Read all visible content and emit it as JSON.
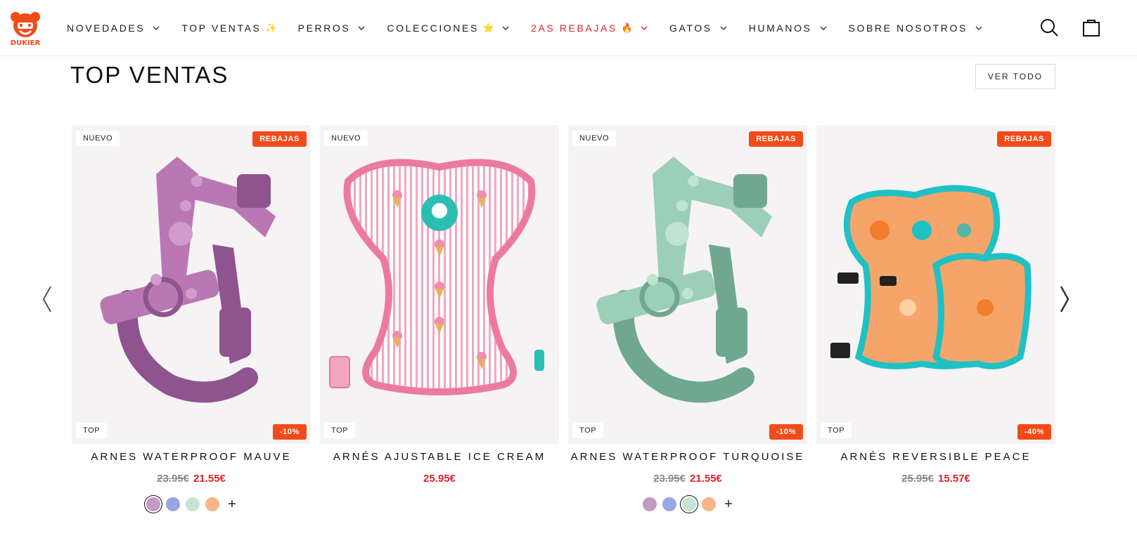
{
  "header": {
    "logo_text": "DUKIER",
    "nav": [
      {
        "label": "NOVEDADES",
        "emoji": "",
        "chevron": true,
        "sale": false
      },
      {
        "label": "TOP VENTAS",
        "emoji": "✨",
        "chevron": false,
        "sale": false
      },
      {
        "label": "PERROS",
        "emoji": "",
        "chevron": true,
        "sale": false
      },
      {
        "label": "COLECCIONES",
        "emoji": "⭐",
        "chevron": true,
        "sale": false
      },
      {
        "label": "2AS REBAJAS",
        "emoji": "🔥",
        "chevron": true,
        "sale": true
      },
      {
        "label": "GATOS",
        "emoji": "",
        "chevron": true,
        "sale": false
      },
      {
        "label": "HUMANOS",
        "emoji": "",
        "chevron": true,
        "sale": false
      },
      {
        "label": "SOBRE NOSOTROS",
        "emoji": "",
        "chevron": true,
        "sale": false
      }
    ],
    "icons": [
      "search-icon",
      "cart-icon"
    ]
  },
  "section": {
    "title": "TOP VENTAS",
    "view_all": "VER TODO"
  },
  "colors": {
    "brand": "#f14b19",
    "sale_text": "#e0212f"
  },
  "products": [
    {
      "badge_new": "NUEVO",
      "badge_sale": "REBAJAS",
      "badge_top": "TOP",
      "badge_discount": "-10%",
      "title": "ARNES WATERPROOF MAUVE",
      "old_price": "23.95€",
      "price": "21.55€",
      "variant": "mauve",
      "swatches": [
        "#c39ac4",
        "#98a6e6",
        "#c8e3d4",
        "#f7b48a"
      ],
      "selected_swatch": 0,
      "more": "+"
    },
    {
      "badge_new": "NUEVO",
      "badge_sale": "",
      "badge_top": "TOP",
      "badge_discount": "",
      "title": "ARNÉS AJUSTABLE ICE CREAM",
      "old_price": "",
      "price": "25.95€",
      "variant": "icecream",
      "swatches": [],
      "selected_swatch": -1,
      "more": ""
    },
    {
      "badge_new": "NUEVO",
      "badge_sale": "REBAJAS",
      "badge_top": "TOP",
      "badge_discount": "-10%",
      "title": "ARNES WATERPROOF TURQUOISE",
      "old_price": "23.95€",
      "price": "21.55€",
      "variant": "turquoise",
      "swatches": [
        "#c39ac4",
        "#98a6e6",
        "#c8e3d4",
        "#f7b48a"
      ],
      "selected_swatch": 2,
      "more": "+"
    },
    {
      "badge_new": "",
      "badge_sale": "REBAJAS",
      "badge_top": "TOP",
      "badge_discount": "-40%",
      "title": "ARNÉS REVERSIBLE PEACE",
      "old_price": "25.95€",
      "price": "15.57€",
      "variant": "peace",
      "swatches": [],
      "selected_swatch": -1,
      "more": ""
    }
  ]
}
